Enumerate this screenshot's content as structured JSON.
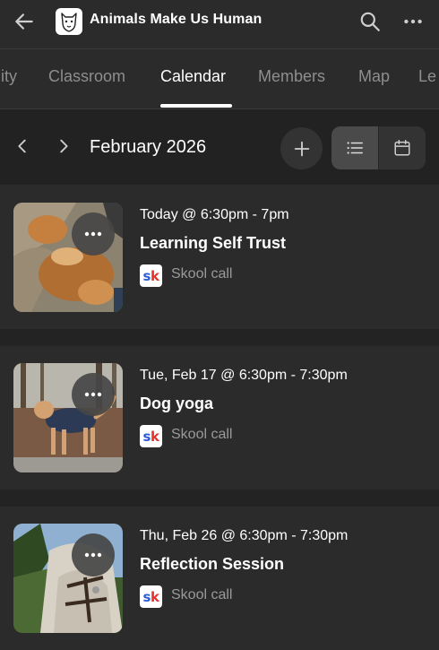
{
  "header": {
    "title": "Animals Make Us Human",
    "back_icon": "arrow-left-icon",
    "search_icon": "search-icon",
    "more_icon": "more-horizontal-icon"
  },
  "tabs": [
    {
      "label": "nity",
      "active": false
    },
    {
      "label": "Classroom",
      "active": false
    },
    {
      "label": "Calendar",
      "active": true
    },
    {
      "label": "Members",
      "active": false
    },
    {
      "label": "Map",
      "active": false
    },
    {
      "label": "Le",
      "active": false
    }
  ],
  "calendar": {
    "month": "February 2026",
    "view": "list"
  },
  "events": [
    {
      "time": "Today @ 6:30pm - 7pm",
      "title": "Learning Self Trust",
      "location": "Skool call",
      "badge": "sk"
    },
    {
      "time": "Tue, Feb 17 @ 6:30pm - 7:30pm",
      "title": "Dog yoga",
      "location": "Skool call",
      "badge": "sk"
    },
    {
      "time": "Thu, Feb 26 @ 6:30pm - 7:30pm",
      "title": "Reflection Session",
      "location": "Skool call",
      "badge": "sk"
    }
  ],
  "colors": {
    "background": "#2b2b2b",
    "header_band": "#222222",
    "muted_text": "#8e8e8e",
    "skool_blue": "#2e5bd6",
    "skool_red": "#e5322d"
  }
}
